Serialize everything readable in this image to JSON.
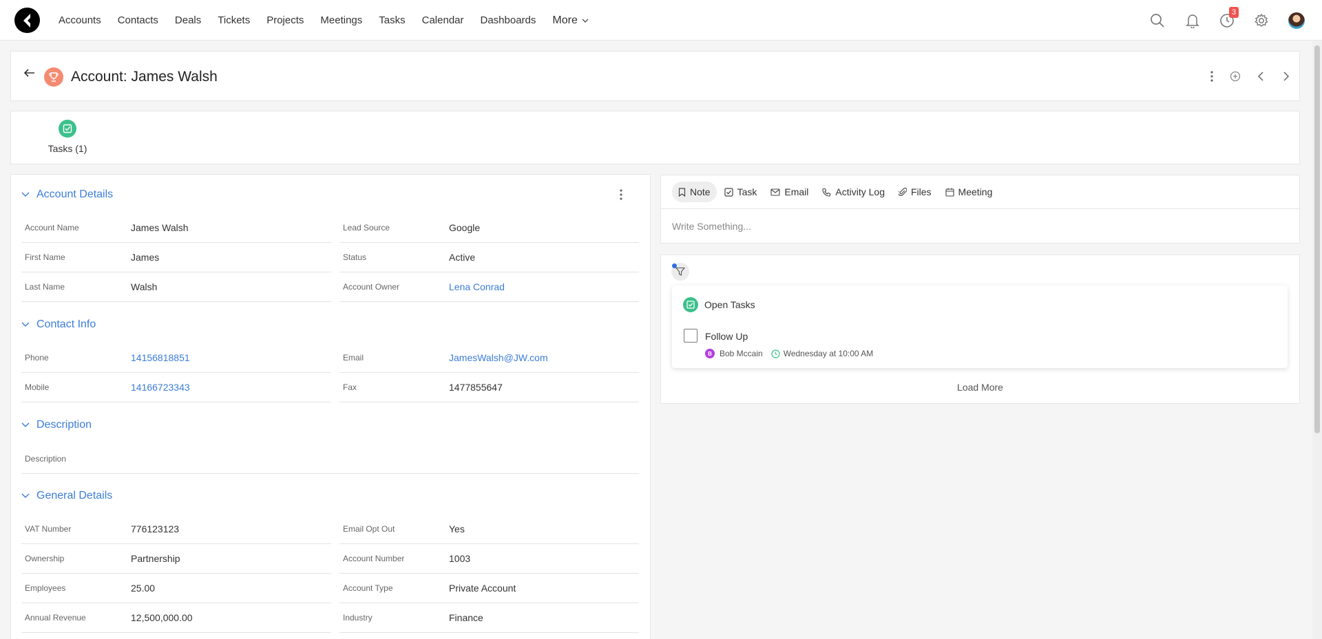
{
  "nav": {
    "items": [
      "Accounts",
      "Contacts",
      "Deals",
      "Tickets",
      "Projects",
      "Meetings",
      "Tasks",
      "Calendar",
      "Dashboards"
    ],
    "more_label": "More",
    "reminder_count": "3"
  },
  "header": {
    "title": "Account: James Walsh"
  },
  "related": {
    "tasks_label": "Tasks (1)"
  },
  "sections": {
    "account_details": "Account Details",
    "contact_info": "Contact Info",
    "description": "Description",
    "general_details": "General Details"
  },
  "account_details": {
    "account_name": {
      "label": "Account Name",
      "value": "James Walsh"
    },
    "lead_source": {
      "label": "Lead Source",
      "value": "Google"
    },
    "first_name": {
      "label": "First Name",
      "value": "James"
    },
    "status": {
      "label": "Status",
      "value": "Active"
    },
    "last_name": {
      "label": "Last Name",
      "value": "Walsh"
    },
    "account_owner": {
      "label": "Account Owner",
      "value": "Lena Conrad"
    }
  },
  "contact_info": {
    "phone": {
      "label": "Phone",
      "value": "14156818851"
    },
    "email": {
      "label": "Email",
      "value": "JamesWalsh@JW.com"
    },
    "mobile": {
      "label": "Mobile",
      "value": "14166723343"
    },
    "fax": {
      "label": "Fax",
      "value": "1477855647"
    }
  },
  "description": {
    "label": "Description",
    "value": ""
  },
  "general_details": {
    "vat_number": {
      "label": "VAT Number",
      "value": "776123123"
    },
    "email_opt_out": {
      "label": "Email Opt Out",
      "value": "Yes"
    },
    "ownership": {
      "label": "Ownership",
      "value": "Partnership"
    },
    "account_number": {
      "label": "Account Number",
      "value": "1003"
    },
    "employees": {
      "label": "Employees",
      "value": "25.00"
    },
    "account_type": {
      "label": "Account Type",
      "value": "Private Account"
    },
    "annual_revenue": {
      "label": "Annual Revenue",
      "value": "12,500,000.00"
    },
    "industry": {
      "label": "Industry",
      "value": "Finance"
    }
  },
  "composer": {
    "tabs": [
      "Note",
      "Task",
      "Email",
      "Activity Log",
      "Files",
      "Meeting"
    ],
    "active_tab": "Note",
    "placeholder": "Write Something..."
  },
  "activity": {
    "open_tasks_title": "Open Tasks",
    "task": {
      "name": "Follow Up",
      "owner_initial": "B",
      "owner": "Bob Mccain",
      "due": "Wednesday at 10:00 AM"
    },
    "load_more": "Load More"
  },
  "colors": {
    "link_blue": "#3b7dd8",
    "task_green": "#3cc08c",
    "account_icon": "#f48b71",
    "badge_red": "#ef5350",
    "owner_purple": "#b23ee0"
  }
}
